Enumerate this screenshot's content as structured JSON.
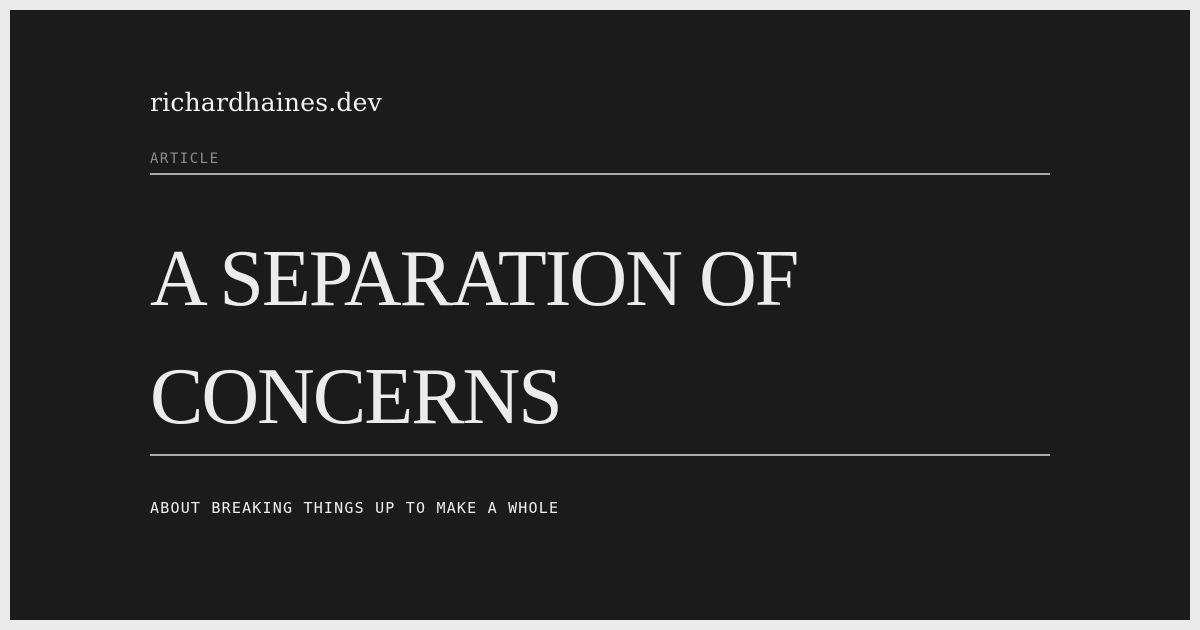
{
  "site": {
    "name": "richardhaines.dev"
  },
  "article": {
    "kicker": "ARTICLE",
    "title": "A SEPARATION OF CONCERNS",
    "subtitle": "ABOUT BREAKING THINGS UP TO MAKE A WHOLE"
  }
}
